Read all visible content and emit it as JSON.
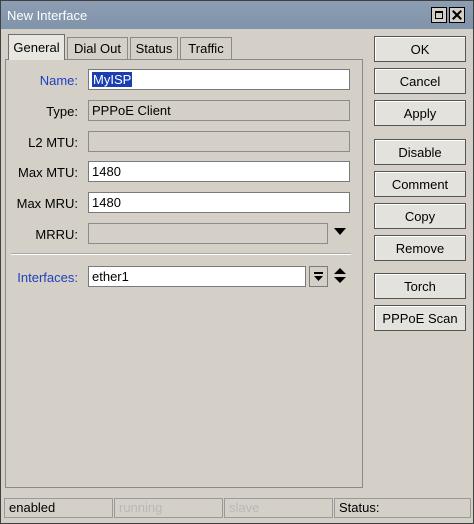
{
  "window": {
    "title": "New Interface"
  },
  "tabs": [
    {
      "label": "General"
    },
    {
      "label": "Dial Out"
    },
    {
      "label": "Status"
    },
    {
      "label": "Traffic"
    }
  ],
  "form": {
    "name": {
      "label": "Name:",
      "value": "MyISP"
    },
    "type": {
      "label": "Type:",
      "value": "PPPoE Client"
    },
    "l2mtu": {
      "label": "L2 MTU:",
      "value": ""
    },
    "max_mtu": {
      "label": "Max MTU:",
      "value": "1480"
    },
    "max_mru": {
      "label": "Max MRU:",
      "value": "1480"
    },
    "mrru": {
      "label": "MRRU:",
      "value": ""
    },
    "interfaces": {
      "label": "Interfaces:",
      "value": "ether1"
    }
  },
  "buttons": {
    "ok": "OK",
    "cancel": "Cancel",
    "apply": "Apply",
    "disable": "Disable",
    "comment": "Comment",
    "copy": "Copy",
    "remove": "Remove",
    "torch": "Torch",
    "pppoe_scan": "PPPoE Scan"
  },
  "statusbar": {
    "state": "enabled",
    "running": "running",
    "slave": "slave",
    "status": "Status:"
  },
  "icons": {
    "dropdown": "triangle-down-icon",
    "list_toggle": "dropdown-list-icon",
    "updown": "up-down-arrows-icon"
  }
}
